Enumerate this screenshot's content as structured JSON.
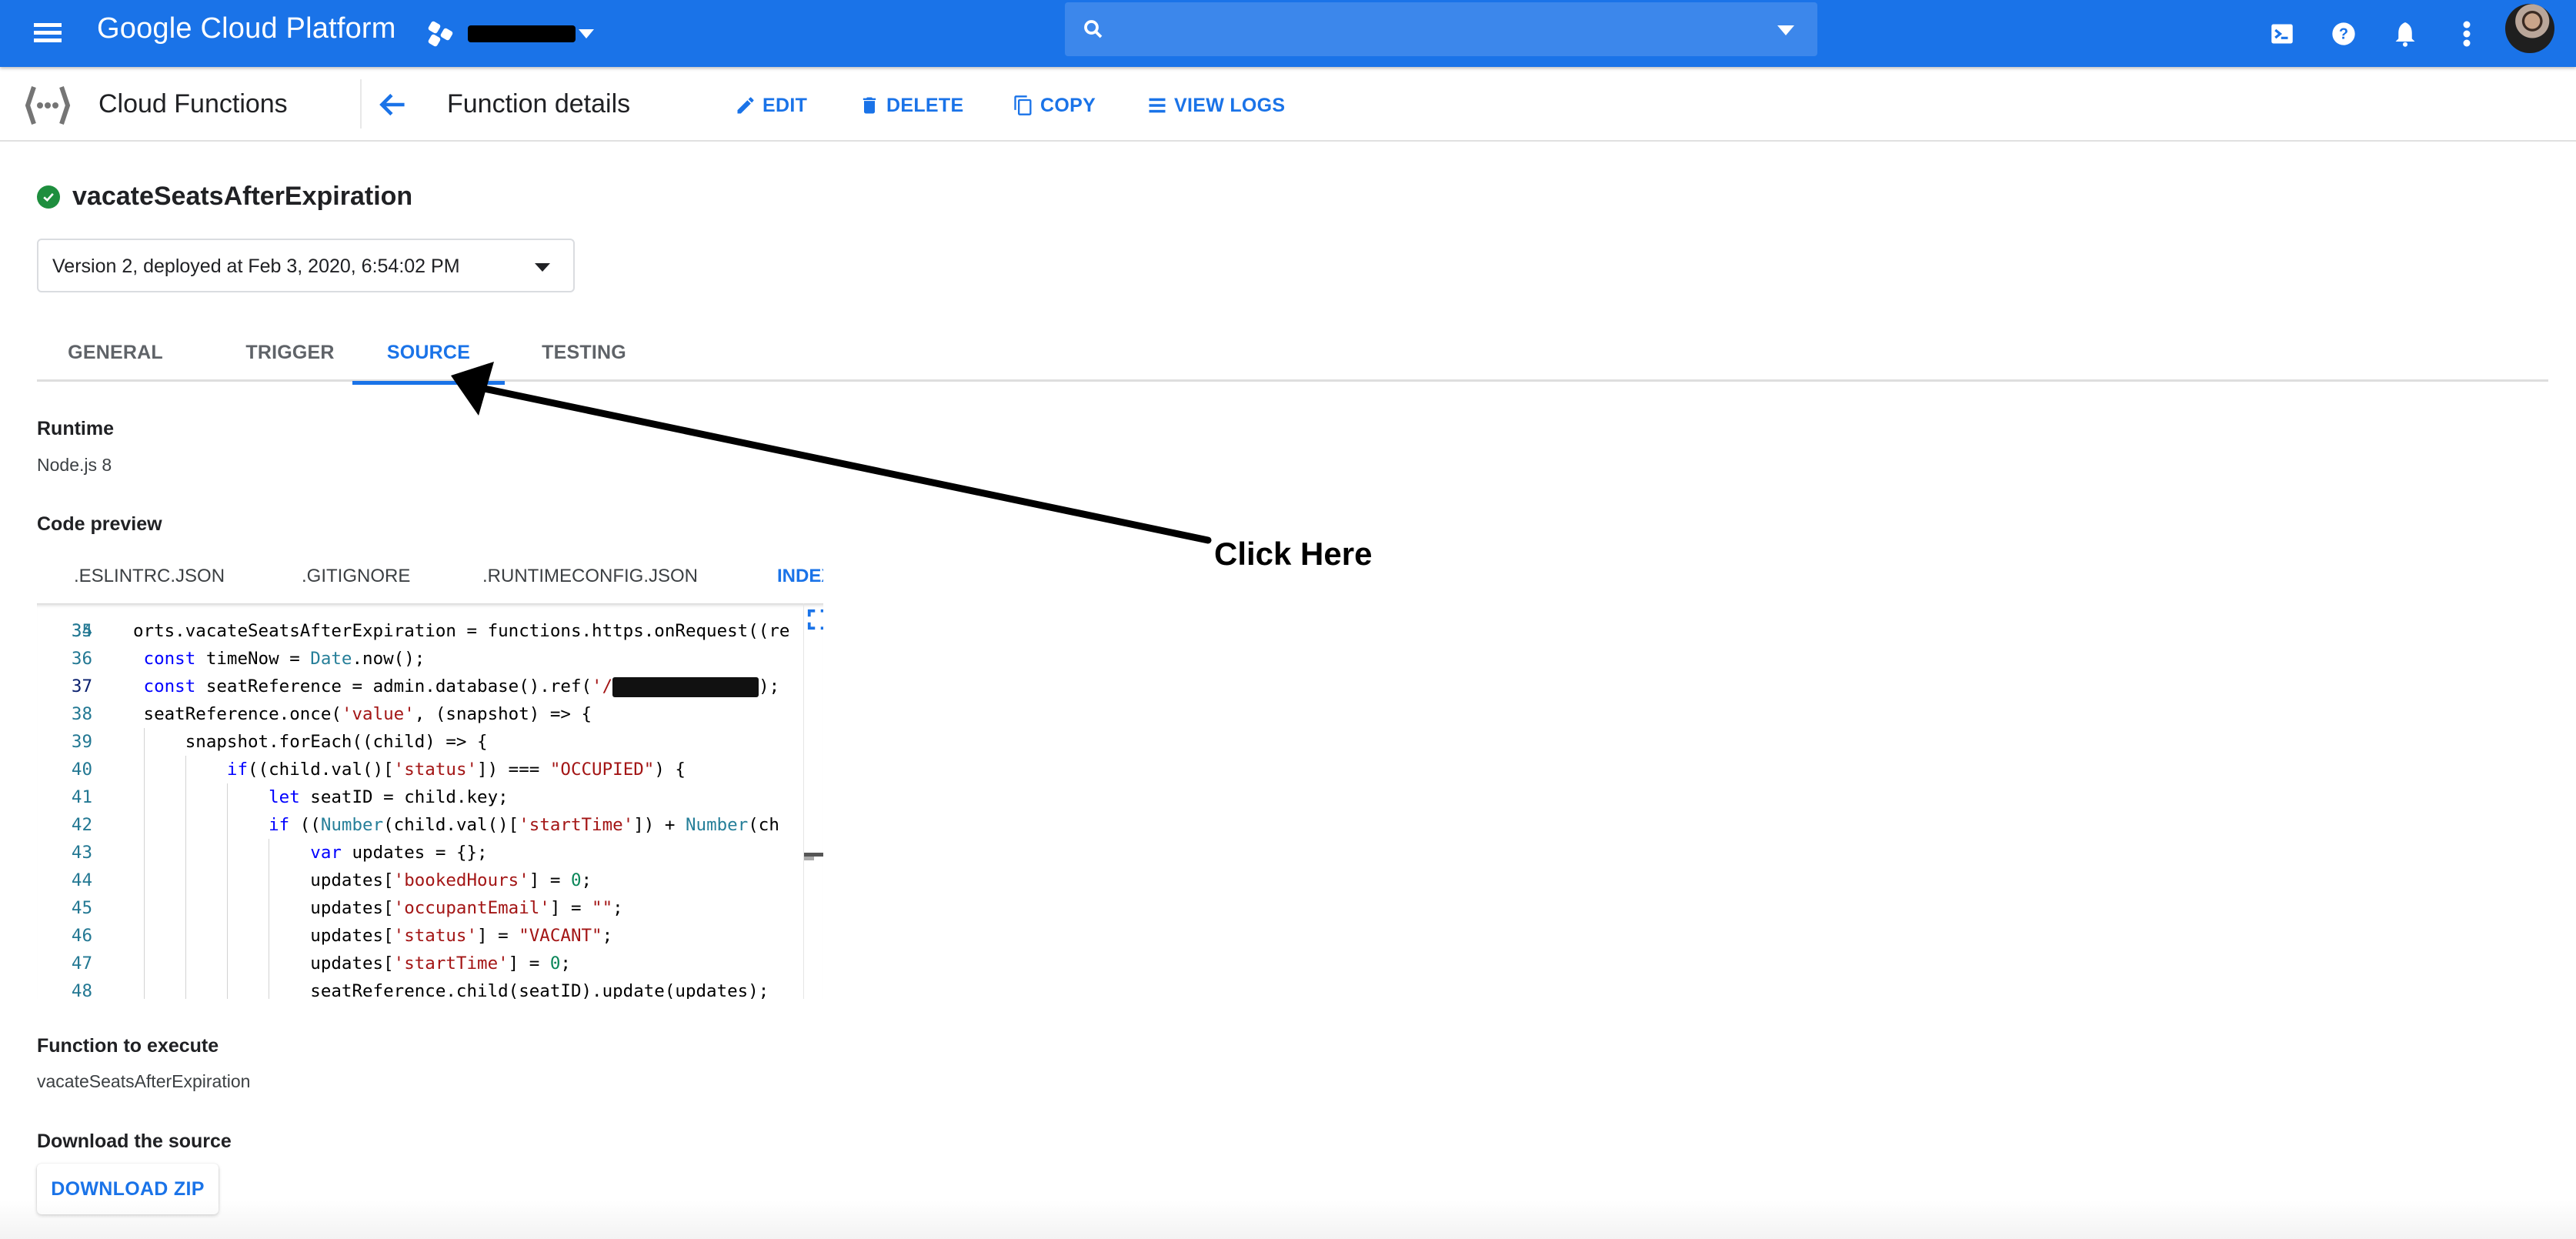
{
  "topbar": {
    "brand": "Google Cloud Platform",
    "project_name": "[redacted]",
    "search_placeholder": "",
    "icons": [
      "menu-icon",
      "project-hex-icon",
      "search-icon",
      "cloud-shell-icon",
      "help-icon",
      "notifications-icon",
      "more-vert-icon",
      "avatar"
    ],
    "accent": "#1a73e8"
  },
  "subheader": {
    "product": "Cloud Functions",
    "page_title": "Function details",
    "actions": [
      {
        "label": "EDIT",
        "icon": "pencil-icon"
      },
      {
        "label": "DELETE",
        "icon": "trash-icon"
      },
      {
        "label": "COPY",
        "icon": "copy-icon"
      },
      {
        "label": "VIEW LOGS",
        "icon": "logs-list-icon"
      }
    ]
  },
  "function": {
    "name": "vacateSeatsAfterExpiration",
    "status": "ok",
    "status_color": "#1e8e3e",
    "version_selected": "Version 2, deployed at Feb 3, 2020, 6:54:02 PM"
  },
  "tabs": [
    {
      "label": "GENERAL",
      "active": false
    },
    {
      "label": "TRIGGER",
      "active": false
    },
    {
      "label": "SOURCE",
      "active": true
    },
    {
      "label": "TESTING",
      "active": false
    }
  ],
  "runtime": {
    "label": "Runtime",
    "value": "Node.js 8"
  },
  "code_preview": {
    "label": "Code preview",
    "files": [
      {
        "label": ".ESLINTRC.JSON",
        "active": false
      },
      {
        "label": ".GITIGNORE",
        "active": false
      },
      {
        "label": ".RUNTIMECONFIG.JSON",
        "active": false
      },
      {
        "label": "INDEX.JS",
        "active": true
      }
    ],
    "partial_top_line": "34",
    "current_line": 37,
    "lines": [
      {
        "num": "35",
        "tokens": [
          [
            "",
            "orts.vacateSeatsAfterExpiration = functions.https.onRequest((re"
          ]
        ]
      },
      {
        "num": "36",
        "tokens": [
          [
            "",
            " "
          ],
          [
            "k",
            "const"
          ],
          [
            "",
            " timeNow = "
          ],
          [
            "t",
            "Date"
          ],
          [
            "",
            ".now();"
          ]
        ]
      },
      {
        "num": "37",
        "tokens": [
          [
            "",
            " "
          ],
          [
            "k",
            "const"
          ],
          [
            "",
            " seatReference = admin.database().ref("
          ],
          [
            "s",
            "'/"
          ],
          [
            "redact",
            ""
          ],
          [
            "",
            ");"
          ]
        ]
      },
      {
        "num": "38",
        "tokens": [
          [
            "",
            " seatReference.once("
          ],
          [
            "s",
            "'value'"
          ],
          [
            "",
            ", (snapshot) => {"
          ]
        ]
      },
      {
        "num": "39",
        "tokens": [
          [
            "",
            "     snapshot.forEach((child) => {"
          ]
        ]
      },
      {
        "num": "40",
        "tokens": [
          [
            "",
            "         "
          ],
          [
            "k",
            "if"
          ],
          [
            "",
            "((child.val()["
          ],
          [
            "s",
            "'status'"
          ],
          [
            "",
            "]) === "
          ],
          [
            "s",
            "\"OCCUPIED\""
          ],
          [
            "",
            ") {"
          ]
        ]
      },
      {
        "num": "41",
        "tokens": [
          [
            "",
            "             "
          ],
          [
            "k",
            "let"
          ],
          [
            "",
            " seatID = child.key;"
          ]
        ]
      },
      {
        "num": "42",
        "tokens": [
          [
            "",
            "             "
          ],
          [
            "k",
            "if"
          ],
          [
            "",
            " (("
          ],
          [
            "t",
            "Number"
          ],
          [
            "",
            "(child.val()["
          ],
          [
            "s",
            "'startTime'"
          ],
          [
            "",
            "]) + "
          ],
          [
            "t",
            "Number"
          ],
          [
            "",
            "(ch"
          ]
        ]
      },
      {
        "num": "43",
        "tokens": [
          [
            "",
            "                 "
          ],
          [
            "k",
            "var"
          ],
          [
            "",
            " updates = {};"
          ]
        ]
      },
      {
        "num": "44",
        "tokens": [
          [
            "",
            "                 updates["
          ],
          [
            "s",
            "'bookedHours'"
          ],
          [
            "",
            "] = "
          ],
          [
            "n",
            "0"
          ],
          [
            "",
            ";"
          ]
        ]
      },
      {
        "num": "45",
        "tokens": [
          [
            "",
            "                 updates["
          ],
          [
            "s",
            "'occupantEmail'"
          ],
          [
            "",
            "] = "
          ],
          [
            "s",
            "\"\""
          ],
          [
            "",
            ";"
          ]
        ]
      },
      {
        "num": "46",
        "tokens": [
          [
            "",
            "                 updates["
          ],
          [
            "s",
            "'status'"
          ],
          [
            "",
            "] = "
          ],
          [
            "s",
            "\"VACANT\""
          ],
          [
            "",
            ";"
          ]
        ]
      },
      {
        "num": "47",
        "tokens": [
          [
            "",
            "                 updates["
          ],
          [
            "s",
            "'startTime'"
          ],
          [
            "",
            "] = "
          ],
          [
            "n",
            "0"
          ],
          [
            "",
            ";"
          ]
        ]
      },
      {
        "num": "48",
        "tokens": [
          [
            "",
            "                 seatReference.child(seatID).update(updates);"
          ]
        ]
      }
    ],
    "syntax_colors": {
      "keyword": "#0000ff",
      "string": "#a31515",
      "type": "#267f99",
      "number": "#098658",
      "line_number": "#237893"
    }
  },
  "function_to_execute": {
    "label": "Function to execute",
    "value": "vacateSeatsAfterExpiration"
  },
  "download": {
    "label": "Download the source",
    "button": "DOWNLOAD ZIP"
  },
  "annotation": {
    "text": "Click Here",
    "points_to": "SOURCE tab"
  }
}
